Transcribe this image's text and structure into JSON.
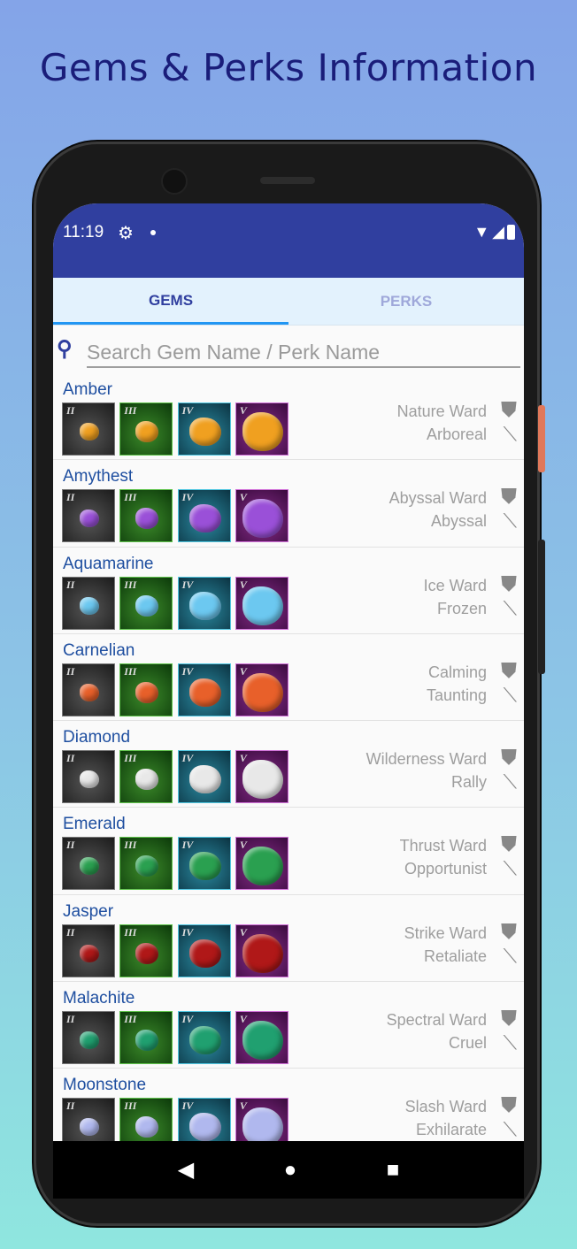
{
  "headline": "Gems & Perks Information",
  "status": {
    "time": "11:19",
    "icons": [
      "gear-icon",
      "notification-dot",
      "wifi-icon",
      "signal-icon",
      "battery-icon"
    ]
  },
  "tabs": [
    {
      "label": "GEMS",
      "active": true
    },
    {
      "label": "PERKS",
      "active": false
    }
  ],
  "search": {
    "placeholder": "Search Gem Name / Perk Name",
    "value": ""
  },
  "tiers": [
    "II",
    "III",
    "IV",
    "V"
  ],
  "gems": [
    {
      "name": "Amber",
      "armor_perk": "Nature Ward",
      "weapon_perk": "Arboreal",
      "color": "#f0a020"
    },
    {
      "name": "Amythest",
      "armor_perk": "Abyssal Ward",
      "weapon_perk": "Abyssal",
      "color": "#9a50d8"
    },
    {
      "name": "Aquamarine",
      "armor_perk": "Ice Ward",
      "weapon_perk": "Frozen",
      "color": "#6cc8f0"
    },
    {
      "name": "Carnelian",
      "armor_perk": "Calming",
      "weapon_perk": "Taunting",
      "color": "#e8602a"
    },
    {
      "name": "Diamond",
      "armor_perk": "Wilderness Ward",
      "weapon_perk": "Rally",
      "color": "#e8e8e8"
    },
    {
      "name": "Emerald",
      "armor_perk": "Thrust Ward",
      "weapon_perk": "Opportunist",
      "color": "#2aa050"
    },
    {
      "name": "Jasper",
      "armor_perk": "Strike Ward",
      "weapon_perk": "Retaliate",
      "color": "#b01818"
    },
    {
      "name": "Malachite",
      "armor_perk": "Spectral Ward",
      "weapon_perk": "Cruel",
      "color": "#20a070"
    },
    {
      "name": "Moonstone",
      "armor_perk": "Slash Ward",
      "weapon_perk": "Exhilarate",
      "color": "#b0b8ee"
    }
  ],
  "nav": [
    "back-icon",
    "home-icon",
    "recents-icon"
  ]
}
